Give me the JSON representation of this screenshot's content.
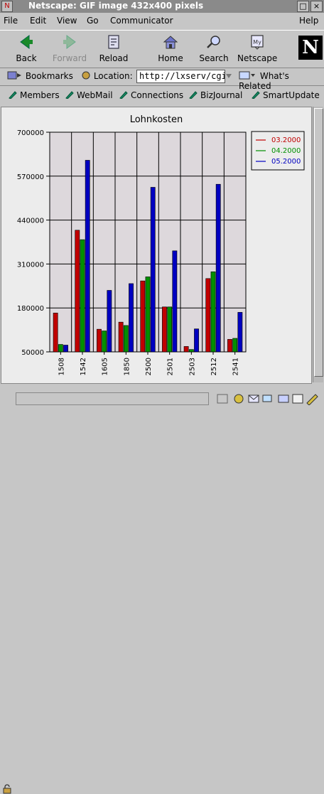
{
  "window": {
    "title": "Netscape: GIF image 432x400 pixels",
    "controls": [
      "□",
      "×"
    ]
  },
  "menu": [
    "File",
    "Edit",
    "View",
    "Go",
    "Communicator",
    "Help"
  ],
  "toolbar": [
    {
      "label": "Back",
      "icon": "back-arrow-icon",
      "enabled": true
    },
    {
      "label": "Forward",
      "icon": "forward-arrow-icon",
      "enabled": false
    },
    {
      "label": "Reload",
      "icon": "reload-icon",
      "enabled": true
    },
    {
      "label": "Home",
      "icon": "home-icon",
      "enabled": true
    },
    {
      "label": "Search",
      "icon": "search-icon",
      "enabled": true
    },
    {
      "label": "Netscape",
      "icon": "netscape-icon",
      "enabled": true
    }
  ],
  "logo": "N",
  "location": {
    "bookmarks": "Bookmarks",
    "label": "Location:",
    "url": "http://lxserv/cgi",
    "related": "What's Related"
  },
  "personal": [
    "Members",
    "WebMail",
    "Connections",
    "BizJournal",
    "SmartUpdate"
  ],
  "chart_data": {
    "type": "bar",
    "title": "Lohnkosten",
    "xlabel": "",
    "ylabel": "",
    "ylim": [
      50000,
      700000
    ],
    "yticks": [
      "50000",
      "180000",
      "310000",
      "440000",
      "570000",
      "700000"
    ],
    "categories": [
      "1508",
      "1542",
      "1605",
      "1850",
      "2500",
      "2501",
      "2503",
      "2512",
      "2541"
    ],
    "series": [
      {
        "name": "03.2000",
        "color": "#c00000",
        "values": [
          165000,
          410000,
          117000,
          138000,
          260000,
          183000,
          66000,
          267000,
          87000
        ]
      },
      {
        "name": "04.2000",
        "color": "#009000",
        "values": [
          72000,
          382000,
          112000,
          128000,
          272000,
          183000,
          57000,
          287000,
          90000
        ]
      },
      {
        "name": "05.2000",
        "color": "#0000c0",
        "values": [
          70000,
          617000,
          232000,
          252000,
          537000,
          349000,
          118000,
          546000,
          167000
        ]
      }
    ],
    "legend": "top-right",
    "grid": true
  }
}
